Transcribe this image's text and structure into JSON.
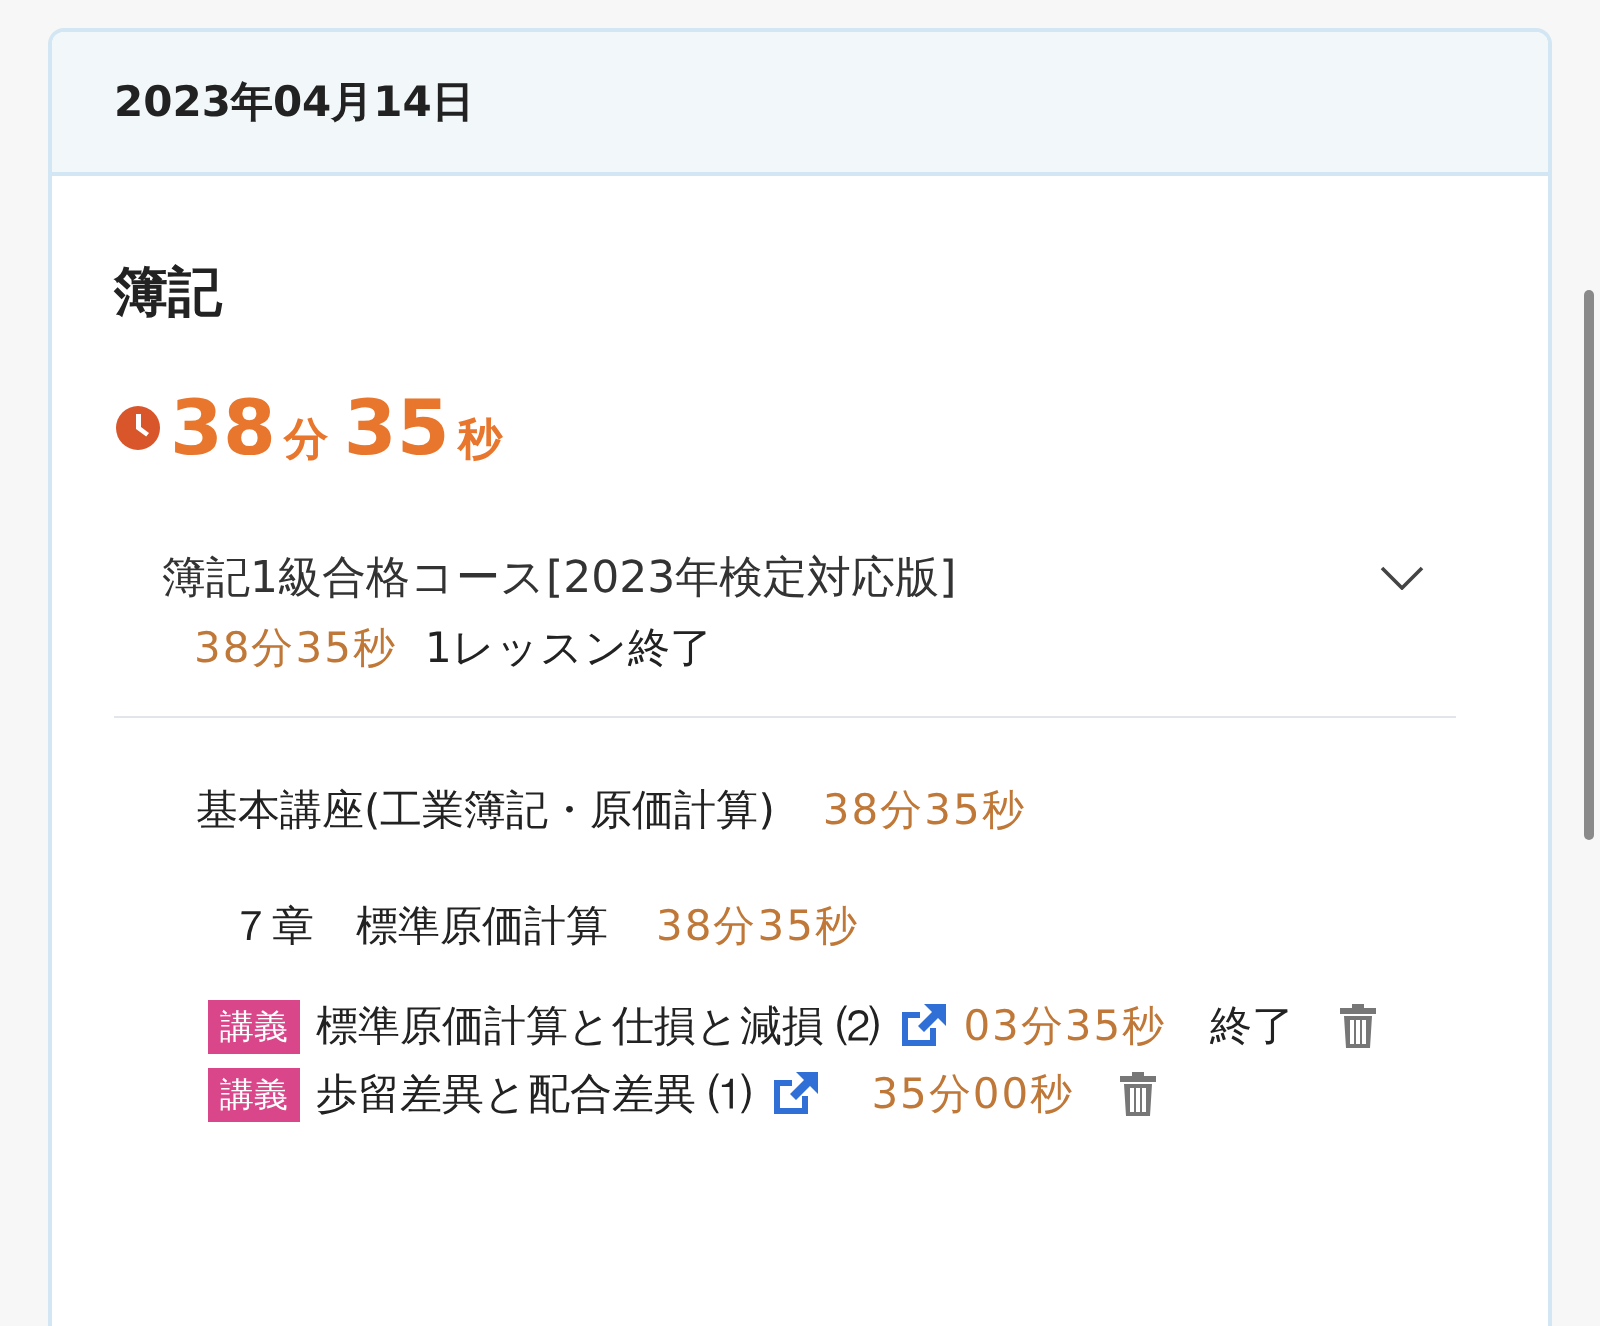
{
  "date": "2023年04月14日",
  "subject": {
    "title": "簿記",
    "total": {
      "minutes": "38",
      "minute_unit": "分",
      "seconds": "35",
      "second_unit": "秒"
    }
  },
  "course": {
    "title": "簿記1級合格コース[2023年検定対応版]",
    "time": "38分35秒",
    "summary": "1レッスン終了",
    "expanded": true,
    "category": {
      "title": "基本講座(工業簿記・原価計算)",
      "time": "38分35秒"
    },
    "chapter": {
      "title": "７章　標準原価計算",
      "time": "38分35秒"
    },
    "lessons": [
      {
        "tag": "講義",
        "title": "標準原価計算と仕損と減損 ⑵",
        "time": "03分35秒",
        "status": "終了"
      },
      {
        "tag": "講義",
        "title": "歩留差異と配合差異 ⑴",
        "time": "35分00秒"
      }
    ]
  }
}
